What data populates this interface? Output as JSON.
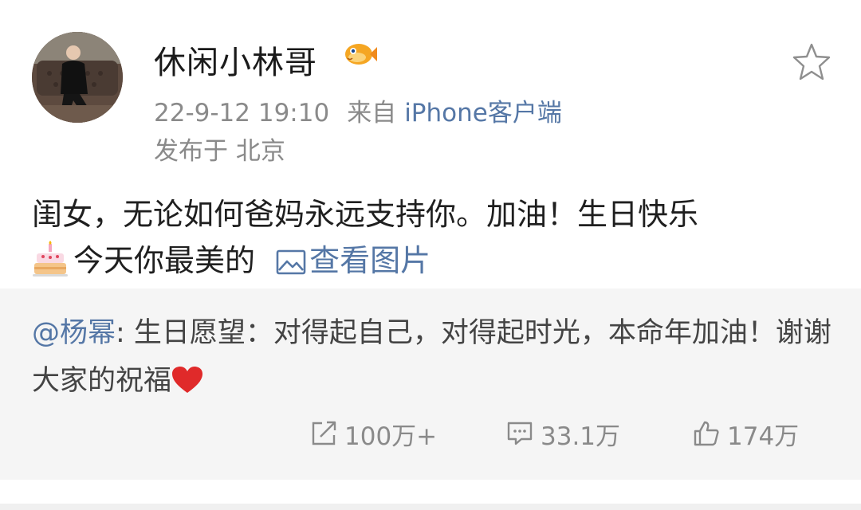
{
  "post": {
    "author": "休闲小林哥",
    "time": "22-9-12 19:10",
    "source_prefix": "来自",
    "source": "iPhone客户端",
    "location": "发布于 北京",
    "text_line1": "闺女，无论如何爸妈永远支持你。加油！生日快乐",
    "text_line2": "今天你最美的",
    "view_pictures": "查看图片",
    "icons": {
      "avatar": "avatar-photo",
      "badge": "fish-badge-icon",
      "favorite": "star-icon",
      "cake": "birthday-cake-emoji",
      "picture": "image-icon"
    }
  },
  "repost": {
    "mention": "@杨幂",
    "text": ": 生日愿望：对得起自己，对得起时光，本命年加油！谢谢大家的祝福",
    "heart_icon": "red-heart-emoji"
  },
  "actions": {
    "forward": {
      "icon": "share-icon",
      "count": "100万+"
    },
    "comment": {
      "icon": "comment-icon",
      "count": "33.1万"
    },
    "like": {
      "icon": "thumbs-up-icon",
      "count": "174万"
    }
  },
  "colors": {
    "link": "#5577a6",
    "meta": "#8a8a8a",
    "repost_bg": "#f5f5f5",
    "heart": "#e02a2a"
  }
}
